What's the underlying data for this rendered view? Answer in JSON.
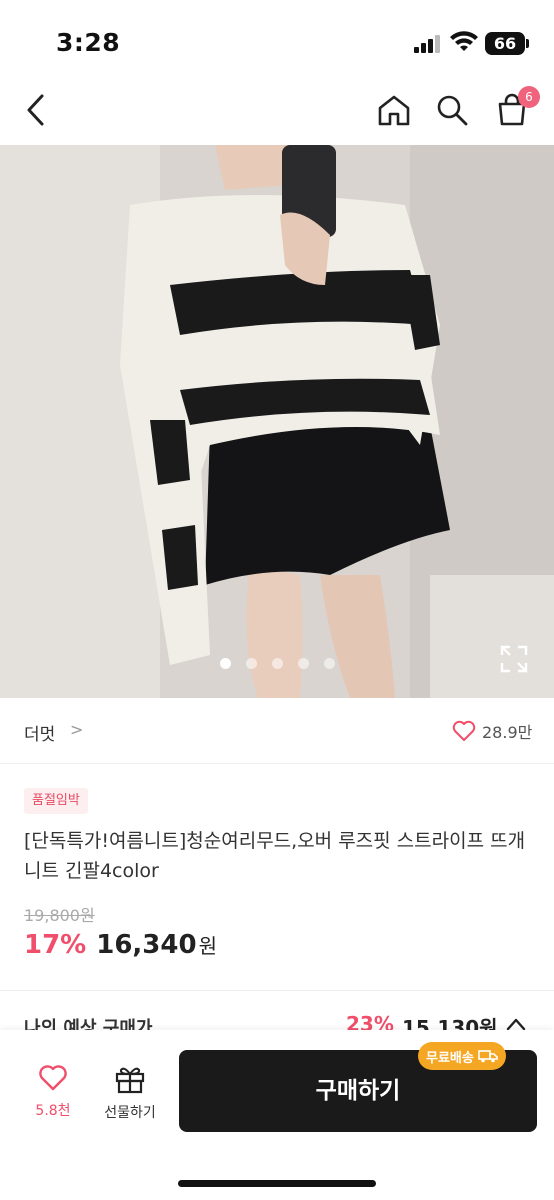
{
  "status_bar": {
    "time": "3:28",
    "battery": "66"
  },
  "nav": {
    "cart_count": "6",
    "icons": [
      "back-icon",
      "home-icon",
      "search-icon",
      "cart-icon"
    ]
  },
  "hero": {
    "image_count": 5,
    "active_index": 0
  },
  "brand": {
    "name": "더멋",
    "chevron": ">",
    "like_count": "28.9만"
  },
  "product": {
    "badge": "품절임박",
    "title": "[단독특가!여름니트]청순여리무드,오버 루즈핏 스트라이프 뜨개 니트 긴팔4color",
    "original_price": "19,800원",
    "discount_rate": "17%",
    "sale_price": "16,340",
    "sale_price_unit": "원"
  },
  "predicted": {
    "label": "나의 예상 구매가",
    "rate": "23%",
    "price": "15,130원"
  },
  "bottom_bar": {
    "wish_count": "5.8천",
    "gift_label": "선물하기",
    "buy_label": "구매하기",
    "free_shipping": "무료배송"
  },
  "colors": {
    "accent": "#f04f6b",
    "buy_button": "#1a1a1a",
    "free_ship": "#f5a623"
  }
}
